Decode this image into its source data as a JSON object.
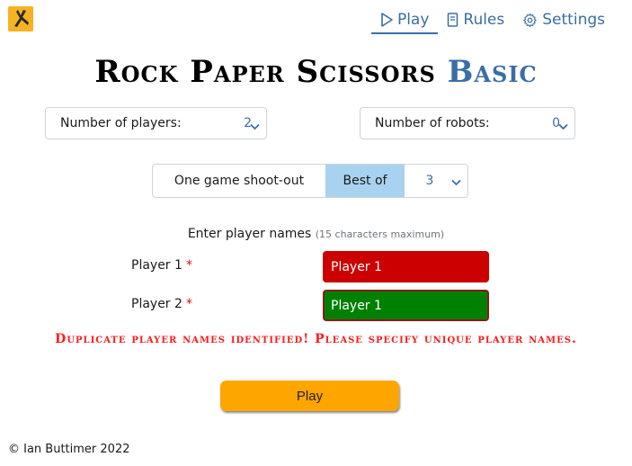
{
  "nav": {
    "play_label": "Play",
    "rules_label": "Rules",
    "settings_label": "Settings",
    "active": "Play",
    "color": "#3a6ea5"
  },
  "title": {
    "main": "Rock Paper Scissors",
    "accent": "Basic"
  },
  "settings": {
    "players_label": "Number of players:",
    "players_value": "2",
    "robots_label": "Number of robots:",
    "robots_value": "0"
  },
  "mode": {
    "option_one": "One game shoot-out",
    "option_two": "Best of",
    "selected": "Best of",
    "best_of_value": "3",
    "selected_color": "#a8d2f0"
  },
  "player_entry": {
    "instruction": "Enter player names",
    "hint": "(15 characters maximum)",
    "players": [
      {
        "label": "Player 1",
        "required": "*",
        "value": "Player 1",
        "color": "#cc0000"
      },
      {
        "label": "Player 2",
        "required": "*",
        "value": "Player 1",
        "color": "#008000"
      }
    ]
  },
  "error": {
    "message": "Duplicate player names identified! Please specify unique player names.",
    "color": "#ff1a1a"
  },
  "play_button": {
    "label": "Play",
    "color": "#ffa500"
  },
  "footer": {
    "copyright": "© Ian Buttimer 2022"
  },
  "icons": {
    "logo": "rock-paper-scissors-logo-icon",
    "play": "play-triangle-icon",
    "rules": "book-icon",
    "settings": "gear-icon",
    "select": "chevron-down-icon"
  }
}
